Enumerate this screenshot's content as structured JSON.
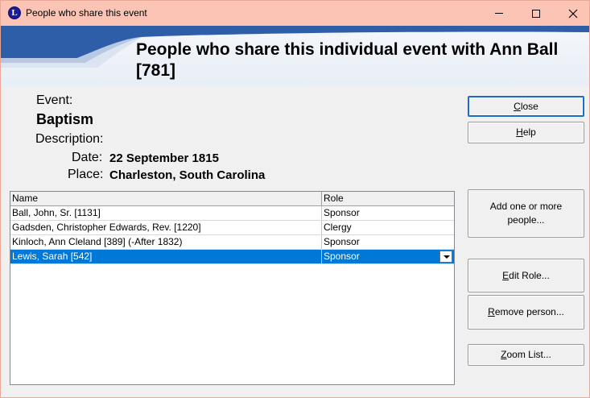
{
  "window": {
    "title": "People who share this event",
    "icon_letter": "L"
  },
  "header": {
    "title": "People who share this individual event with Ann Ball [781]"
  },
  "event": {
    "event_label": "Event:",
    "event_value": "Baptism",
    "description_label": "Description:",
    "date_label": "Date:",
    "date_value": "22 September 1815",
    "place_label": "Place:",
    "place_value": "Charleston, South Carolina"
  },
  "grid": {
    "columns": [
      "Name",
      "Role"
    ],
    "rows": [
      {
        "name": "Ball, John, Sr. [1131]",
        "role": "Sponsor"
      },
      {
        "name": "Gadsden, Christopher Edwards, Rev.  [1220]",
        "role": "Clergy"
      },
      {
        "name": "Kinloch, Ann Cleland [389] (-After 1832)",
        "role": "Sponsor"
      },
      {
        "name": "Lewis, Sarah [542]",
        "role": "Sponsor"
      }
    ],
    "selected_row": 3
  },
  "buttons": {
    "close": {
      "pre": "",
      "u": "C",
      "post": "lose"
    },
    "help": {
      "pre": "",
      "u": "H",
      "post": "elp"
    },
    "add_line1": "Add one or more",
    "add_line2": "people...",
    "edit_role": {
      "pre": "",
      "u": "E",
      "post": "dit Role..."
    },
    "remove_person": {
      "pre": "",
      "u": "R",
      "post": "emove person..."
    },
    "zoom_list": {
      "pre": "",
      "u": "Z",
      "post": "oom List..."
    }
  },
  "colors": {
    "titlebar": "#fbc4b4",
    "selection": "#0078d7",
    "banner_swoosh": "#2f5ea8"
  }
}
